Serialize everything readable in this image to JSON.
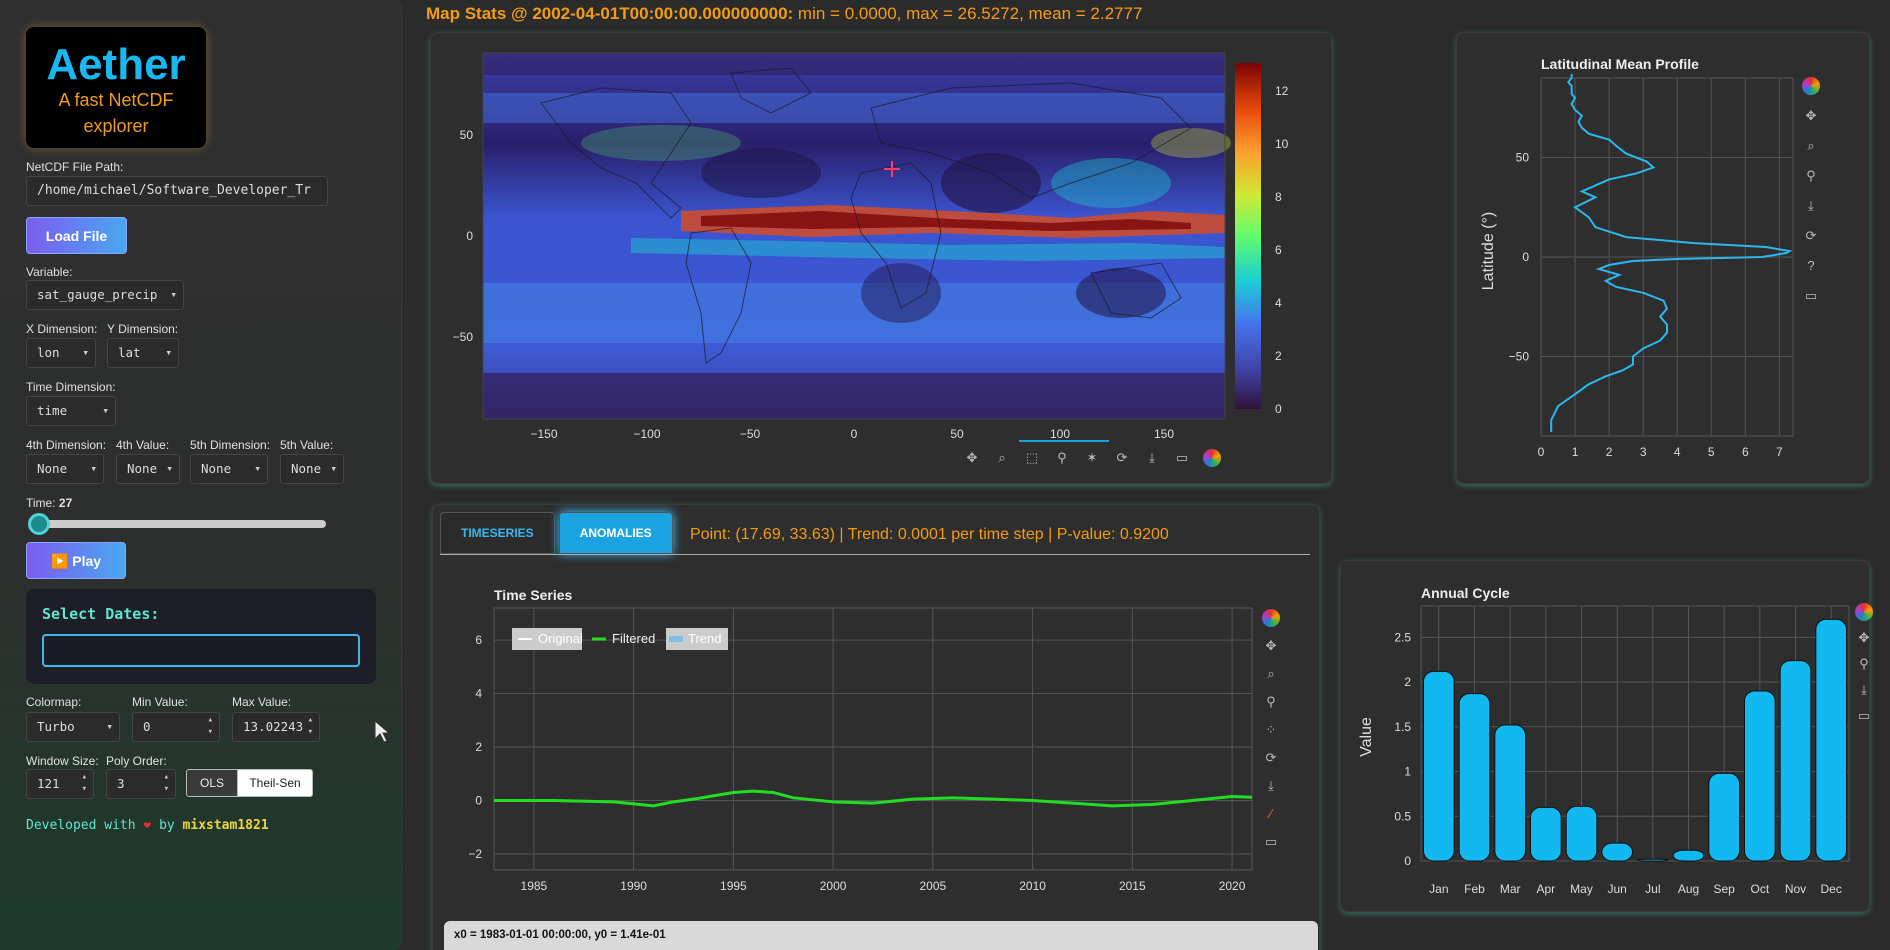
{
  "sidebar": {
    "logo_title": "Aether",
    "logo_subtitle": "A fast NetCDF explorer",
    "file_path_label": "NetCDF File Path:",
    "file_path_value": "/home/michael/Software_Developer_Tr",
    "load_button": "Load File",
    "variable_label": "Variable:",
    "variable_value": "sat_gauge_precip",
    "x_dim_label": "X Dimension:",
    "x_dim_value": "lon",
    "y_dim_label": "Y Dimension:",
    "y_dim_value": "lat",
    "time_dim_label": "Time Dimension:",
    "time_dim_value": "time",
    "dim4_label": "4th Dimension:",
    "dim4_value": "None",
    "val4_label": "4th Value:",
    "val4_value": "None",
    "dim5_label": "5th Dimension:",
    "dim5_value": "None",
    "val5_label": "5th Value:",
    "val5_value": "None",
    "time_label": "Time:",
    "time_value": "27",
    "play_button": "▶️ Play",
    "select_dates_title": "Select Dates:",
    "colormap_label": "Colormap:",
    "colormap_value": "Turbo",
    "min_label": "Min Value:",
    "min_value": "0",
    "max_label": "Max Value:",
    "max_value": "13.02243",
    "window_label": "Window Size:",
    "window_value": "121",
    "poly_label": "Poly Order:",
    "poly_value": "3",
    "ols_button": "OLS",
    "theilsen_button": "Theil-Sen",
    "developed_prefix": "Developed with",
    "developed_by": "by",
    "developer": "mixstam1821"
  },
  "map_stats": {
    "label": "Map Stats @ 2002-04-01T00:00:00.000000000:",
    "values": "min = 0.0000, max = 26.5272, mean = 2.2777"
  },
  "map": {
    "colorbar_ticks": [
      "0",
      "2",
      "4",
      "6",
      "8",
      "10",
      "12"
    ],
    "x_ticks": [
      "−150",
      "−100",
      "−50",
      "0",
      "50",
      "100",
      "150"
    ],
    "y_ticks": [
      "50",
      "0",
      "−50"
    ]
  },
  "lat_profile": {
    "title": "Latitudinal Mean Profile",
    "ylabel": "Latitude (°)",
    "x_ticks": [
      "0",
      "1",
      "2",
      "3",
      "4",
      "5",
      "6",
      "7"
    ],
    "y_ticks": [
      "50",
      "0",
      "−50"
    ]
  },
  "tabs": {
    "timeseries": "TIMESERIES",
    "anomalies": "ANOMALIES"
  },
  "trend_text": "Point: (17.69, 33.63) | Trend: 0.0001 per time step | P-value: 0.9200",
  "timeseries": {
    "title": "Time Series",
    "legend": [
      "Original",
      "Filtered",
      "Trend"
    ],
    "x_ticks": [
      "1985",
      "1990",
      "1995",
      "2000",
      "2005",
      "2010",
      "2015",
      "2020"
    ],
    "y_ticks": [
      "6",
      "4",
      "2",
      "0",
      "−2"
    ]
  },
  "hover": {
    "line1": "x0 = 1983-01-01 00:00:00, y0 = 1.41e-01"
  },
  "chart_data": [
    {
      "type": "bar",
      "title": "Annual Cycle",
      "ylabel": "Value",
      "categories": [
        "Jan",
        "Feb",
        "Mar",
        "Apr",
        "May",
        "Jun",
        "Jul",
        "Aug",
        "Sep",
        "Oct",
        "Nov",
        "Dec"
      ],
      "values": [
        2.12,
        1.87,
        1.52,
        0.6,
        0.61,
        0.2,
        0.02,
        0.12,
        0.98,
        1.9,
        2.24,
        2.7
      ],
      "y_ticks": [
        "0",
        "0.5",
        "1",
        "1.5",
        "2",
        "2.5"
      ],
      "ylim": [
        0,
        2.85
      ],
      "color": "#12b8f0"
    },
    {
      "type": "line",
      "title": "Time Series",
      "series_name": "Filtered",
      "color": "#22dd22",
      "xlim": [
        1983,
        2021
      ],
      "ylim": [
        -2.6,
        7.2
      ],
      "x": [
        1983,
        1986,
        1989,
        1991,
        1992,
        1993,
        1995,
        1996,
        1997,
        1998,
        2000,
        2002,
        2004,
        2006,
        2008,
        2010,
        2012,
        2014,
        2016,
        2018,
        2020,
        2021
      ],
      "y": [
        0.0,
        0.0,
        -0.05,
        -0.2,
        -0.05,
        0.05,
        0.3,
        0.35,
        0.3,
        0.1,
        -0.05,
        -0.1,
        0.05,
        0.1,
        0.05,
        0.0,
        -0.1,
        -0.2,
        -0.15,
        0.0,
        0.15,
        0.12
      ]
    },
    {
      "type": "line",
      "title": "Latitudinal Mean Profile",
      "ylabel": "Latitude (°)",
      "color": "#2bb8f0",
      "xlim": [
        0,
        7.4
      ],
      "ylim": [
        -90,
        90
      ],
      "x": [
        0.3,
        0.35,
        0.5,
        0.8,
        1.2,
        1.7,
        2.2,
        2.7,
        3.3,
        3.7,
        3.8,
        3.6,
        3.2,
        2.3,
        2.0,
        1.8,
        2.2,
        1.6,
        1.9,
        2.5,
        3.5,
        5.0,
        6.8,
        7.1,
        6.6,
        7.0,
        5.0,
        3.0,
        2.5,
        2.2,
        1.8,
        2.5,
        3.0,
        3.5,
        3.7,
        3.6,
        3.2,
        2.7,
        2.0,
        1.5,
        1.3,
        1.1,
        1.0,
        0.9,
        0.8,
        0.9,
        1.0,
        1.1,
        1.2,
        1.5,
        2.0,
        2.7,
        3.4,
        3.8,
        3.2,
        2.5,
        1.7,
        1.3,
        1.1,
        0.9,
        1.0,
        0.9,
        1.0,
        0.9
      ],
      "y": [
        -88,
        -85,
        -80,
        -75,
        -70,
        -66,
        -62,
        -58,
        -54,
        -50,
        -46,
        -42,
        -38,
        -32,
        -28,
        -24,
        -20,
        -17,
        -14,
        -11,
        -8,
        -5,
        -3,
        -1,
        1,
        3,
        5,
        7,
        9,
        12,
        15,
        18,
        22,
        27,
        32,
        38,
        43,
        47,
        50,
        53,
        56,
        59,
        62,
        65,
        68,
        70,
        72,
        75,
        78,
        80,
        82,
        84,
        86,
        87,
        88,
        87,
        86,
        85,
        84,
        82,
        80,
        78,
        76,
        74
      ],
      "note_x": [
        0.3,
        0.3,
        0.5,
        1.0,
        1.4,
        1.9,
        2.4,
        2.7,
        2.7,
        3.0,
        3.5,
        3.7,
        3.7,
        3.5,
        3.7,
        3.6,
        3.0,
        2.2,
        1.9,
        2.3,
        1.7,
        2.0,
        2.7,
        4.0,
        6.5,
        7.2,
        7.3,
        6.6,
        4.5,
        2.5,
        1.6,
        1.4,
        1.0,
        1.6,
        1.2,
        1.6,
        2.0,
        2.8,
        3.3,
        3.1,
        2.5,
        2.2,
        2.0,
        1.4,
        1.2,
        1.1,
        1.2,
        1.0,
        0.9,
        1.0,
        0.9,
        0.9,
        0.9,
        0.8,
        0.9,
        0.9,
        0.9
      ],
      "note_y": [
        -88,
        -82,
        -75,
        -69,
        -64,
        -60,
        -57,
        -54,
        -50,
        -46,
        -42,
        -38,
        -34,
        -30,
        -26,
        -22,
        -18,
        -15,
        -12,
        -9,
        -6,
        -4,
        -2,
        -1,
        0,
        2,
        3,
        5,
        7,
        10,
        15,
        20,
        25,
        30,
        33,
        36,
        39,
        42,
        45,
        48,
        52,
        56,
        59,
        62,
        65,
        68,
        71,
        74,
        77,
        80,
        82,
        84,
        86,
        88,
        90,
        91,
        92
      ]
    }
  ]
}
